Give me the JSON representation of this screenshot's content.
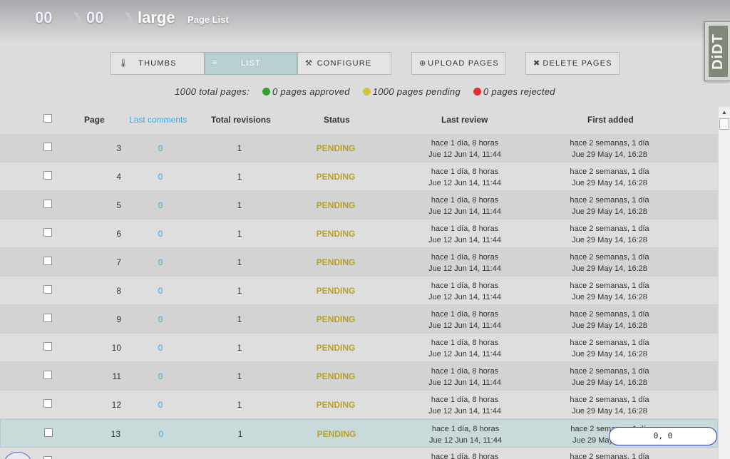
{
  "breadcrumb": {
    "items": [
      "00",
      "00",
      "large"
    ],
    "page_label": "Page List",
    "separator": "❯"
  },
  "logo": {
    "text": "DiDT"
  },
  "toolbar": {
    "thumbs_label": "THUMBS",
    "list_label": "LIST",
    "configure_label": "CONFIGURE",
    "upload_label": "UPLOAD PAGES",
    "delete_label": "DELETE PAGES",
    "thumbs_icon": "eyedropper-icon",
    "list_icon": "list-icon",
    "configure_icon": "wrench-icon",
    "upload_icon": "plus-circle-icon",
    "delete_icon": "close-icon"
  },
  "summary": {
    "total": "1000 total pages:",
    "approved": "0 pages approved",
    "pending": "1000 pages pending",
    "rejected": "0 pages rejected",
    "colors": {
      "approved": "#2fa02f",
      "pending": "#d8c23a",
      "rejected": "#e03030"
    }
  },
  "table": {
    "headers": {
      "page": "Page",
      "last_comments": "Last comments",
      "total_revisions": "Total revisions",
      "status": "Status",
      "last_review": "Last review",
      "first_added": "First added"
    },
    "rows": [
      {
        "page": "3",
        "comments": "0",
        "revisions": "1",
        "status": "PENDING",
        "review_rel": "hace 1 día, 8 horas",
        "review_date": "Jue 12 Jun 14, 11:44",
        "added_rel": "hace 2 semanas, 1 día",
        "added_date": "Jue 29 May 14, 16:28"
      },
      {
        "page": "4",
        "comments": "0",
        "revisions": "1",
        "status": "PENDING",
        "review_rel": "hace 1 día, 8 horas",
        "review_date": "Jue 12 Jun 14, 11:44",
        "added_rel": "hace 2 semanas, 1 día",
        "added_date": "Jue 29 May 14, 16:28"
      },
      {
        "page": "5",
        "comments": "0",
        "revisions": "1",
        "status": "PENDING",
        "review_rel": "hace 1 día, 8 horas",
        "review_date": "Jue 12 Jun 14, 11:44",
        "added_rel": "hace 2 semanas, 1 día",
        "added_date": "Jue 29 May 14, 16:28"
      },
      {
        "page": "6",
        "comments": "0",
        "revisions": "1",
        "status": "PENDING",
        "review_rel": "hace 1 día, 8 horas",
        "review_date": "Jue 12 Jun 14, 11:44",
        "added_rel": "hace 2 semanas, 1 día",
        "added_date": "Jue 29 May 14, 16:28"
      },
      {
        "page": "7",
        "comments": "0",
        "revisions": "1",
        "status": "PENDING",
        "review_rel": "hace 1 día, 8 horas",
        "review_date": "Jue 12 Jun 14, 11:44",
        "added_rel": "hace 2 semanas, 1 día",
        "added_date": "Jue 29 May 14, 16:28"
      },
      {
        "page": "8",
        "comments": "0",
        "revisions": "1",
        "status": "PENDING",
        "review_rel": "hace 1 día, 8 horas",
        "review_date": "Jue 12 Jun 14, 11:44",
        "added_rel": "hace 2 semanas, 1 día",
        "added_date": "Jue 29 May 14, 16:28"
      },
      {
        "page": "9",
        "comments": "0",
        "revisions": "1",
        "status": "PENDING",
        "review_rel": "hace 1 día, 8 horas",
        "review_date": "Jue 12 Jun 14, 11:44",
        "added_rel": "hace 2 semanas, 1 día",
        "added_date": "Jue 29 May 14, 16:28"
      },
      {
        "page": "10",
        "comments": "0",
        "revisions": "1",
        "status": "PENDING",
        "review_rel": "hace 1 día, 8 horas",
        "review_date": "Jue 12 Jun 14, 11:44",
        "added_rel": "hace 2 semanas, 1 día",
        "added_date": "Jue 29 May 14, 16:28"
      },
      {
        "page": "11",
        "comments": "0",
        "revisions": "1",
        "status": "PENDING",
        "review_rel": "hace 1 día, 8 horas",
        "review_date": "Jue 12 Jun 14, 11:44",
        "added_rel": "hace 2 semanas, 1 día",
        "added_date": "Jue 29 May 14, 16:28"
      },
      {
        "page": "12",
        "comments": "0",
        "revisions": "1",
        "status": "PENDING",
        "review_rel": "hace 1 día, 8 horas",
        "review_date": "Jue 12 Jun 14, 11:44",
        "added_rel": "hace 2 semanas, 1 día",
        "added_date": "Jue 29 May 14, 16:28"
      },
      {
        "page": "13",
        "comments": "0",
        "revisions": "1",
        "status": "PENDING",
        "review_rel": "hace 1 día, 8 horas",
        "review_date": "Jue 12 Jun 14, 11:44",
        "added_rel": "hace 2 semanas, 1 día",
        "added_date": "Jue 29 May 14, 16:28"
      },
      {
        "page": "",
        "comments": "",
        "revisions": "",
        "status": "",
        "review_rel": "hace 1 día, 8 horas",
        "review_date": "",
        "added_rel": "hace 2 semanas, 1 día",
        "added_date": ""
      }
    ],
    "hover_row_index": 10,
    "status_color": "#b9a02a"
  },
  "coords_readout": "0, 0"
}
